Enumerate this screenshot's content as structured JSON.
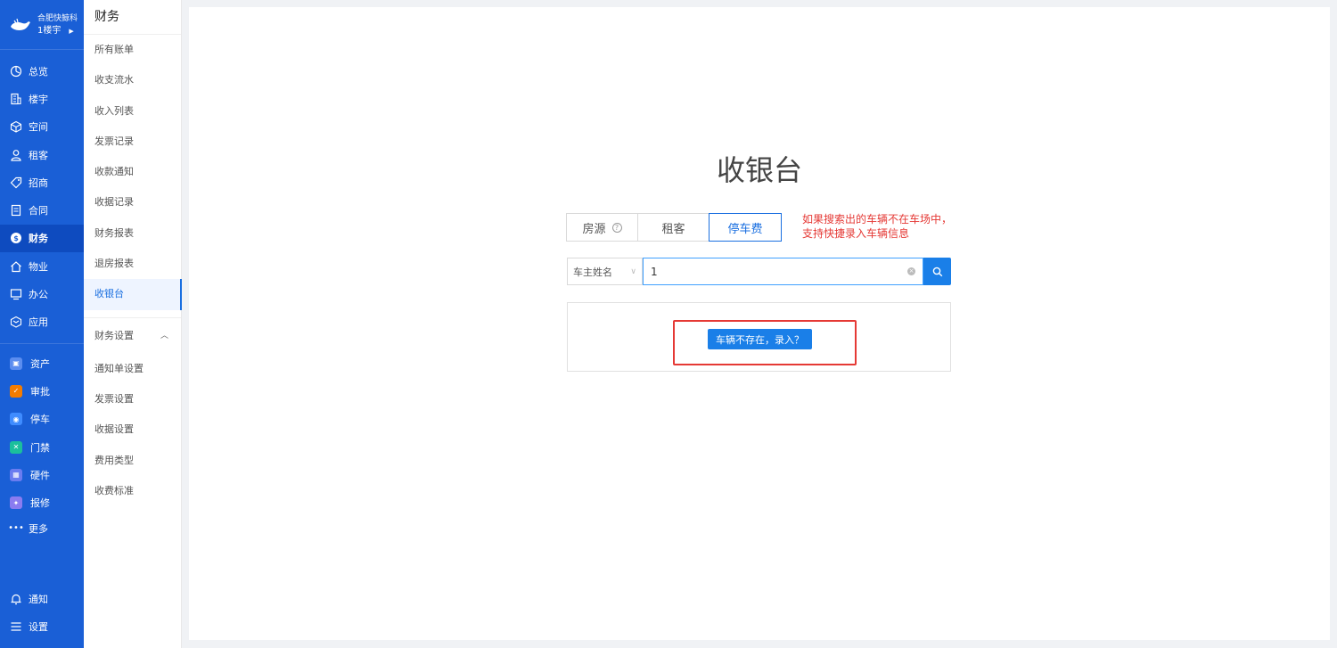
{
  "brand": {
    "name": "合肥快鲸科",
    "building": "1楼宇"
  },
  "nav": {
    "items": [
      {
        "label": "总览",
        "icon": "dashboard-icon"
      },
      {
        "label": "楼宇",
        "icon": "building-icon"
      },
      {
        "label": "空间",
        "icon": "cube-icon"
      },
      {
        "label": "租客",
        "icon": "tenant-icon"
      },
      {
        "label": "招商",
        "icon": "tag-icon"
      },
      {
        "label": "合同",
        "icon": "document-icon"
      },
      {
        "label": "财务",
        "icon": "finance-icon"
      },
      {
        "label": "物业",
        "icon": "home-icon"
      },
      {
        "label": "办公",
        "icon": "monitor-icon"
      },
      {
        "label": "应用",
        "icon": "app-icon"
      }
    ],
    "apps": [
      {
        "label": "资产",
        "color": "#5b8def"
      },
      {
        "label": "审批",
        "color": "#f57c00"
      },
      {
        "label": "停车",
        "color": "#3f8cff"
      },
      {
        "label": "门禁",
        "color": "#1bbf9c"
      },
      {
        "label": "硬件",
        "color": "#6a7cf0"
      },
      {
        "label": "报修",
        "color": "#8a7cf0"
      }
    ],
    "more": "更多",
    "notify": "通知",
    "settings": "设置"
  },
  "submenu": {
    "title": "财务",
    "items": [
      "所有账单",
      "收支流水",
      "收入列表",
      "发票记录",
      "收款通知",
      "收据记录",
      "财务报表",
      "退房报表",
      "收银台"
    ],
    "group": "财务设置",
    "group_items": [
      "通知单设置",
      "发票设置",
      "收据设置",
      "费用类型",
      "收费标准"
    ]
  },
  "main": {
    "title": "收银台",
    "tabs": [
      "房源",
      "租客",
      "停车费"
    ],
    "note_line1": "如果搜索出的车辆不在车场中，",
    "note_line2": "支持快捷录入车辆信息",
    "search_type": "车主姓名",
    "search_value": "1",
    "result_button": "车辆不存在，录入？"
  },
  "colors": {
    "nav_bg": "#1a5fd6",
    "accent": "#1a6fe0",
    "alert": "#e53935"
  }
}
